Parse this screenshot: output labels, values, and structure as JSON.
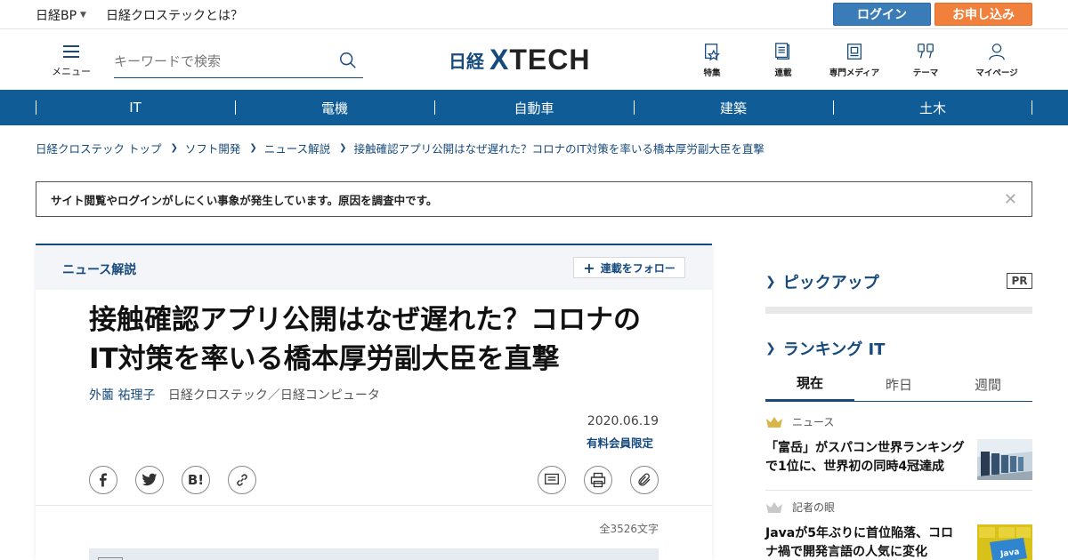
{
  "topbar": {
    "nikkei_bp": "日経BP",
    "about": "日経クロステックとは？",
    "login": "ログイン",
    "apply": "お申し込み"
  },
  "header": {
    "menu_label": "メニュー",
    "search_placeholder": "キーワードで検索",
    "logo_nikkei": "日経",
    "logo_x": "X",
    "logo_tech": "TECH",
    "nav": [
      {
        "label": "特集",
        "icon": "feature-icon"
      },
      {
        "label": "連載",
        "icon": "series-icon"
      },
      {
        "label": "専門メディア",
        "icon": "media-icon"
      },
      {
        "label": "テーマ",
        "icon": "theme-icon"
      },
      {
        "label": "マイページ",
        "icon": "user-icon"
      }
    ]
  },
  "categories": [
    "IT",
    "電機",
    "自動車",
    "建築",
    "土木"
  ],
  "breadcrumb": [
    "日経クロステック トップ",
    "ソフト開発",
    "ニュース解説",
    "接触確認アプリ公開はなぜ遅れた？コロナのIT対策を率いる橋本厚労副大臣を直撃"
  ],
  "notice": {
    "text": "サイト閲覧やログインがしにくい事象が発生しています。原因を調査中です。",
    "close": "✕"
  },
  "article": {
    "series": "ニュース解説",
    "follow": "連載をフォロー",
    "follow_plus": "+",
    "headline": "接触確認アプリ公開はなぜ遅れた？コロナのIT対策を率いる橋本厚労副大臣を直撃",
    "author": "外薗 祐理子",
    "publication": "日経クロステック／日経コンピュータ",
    "date": "2020.06.19",
    "paid": "有料会員限定",
    "word_count": "全3526文字",
    "share_icons": [
      "f",
      "t",
      "B!",
      "link"
    ],
    "tool_icons": [
      "comment",
      "print",
      "clip"
    ]
  },
  "sidebar": {
    "pickup": "ピックアップ",
    "pr": "PR",
    "ranking": "ランキング IT",
    "tabs": [
      "現在",
      "昨日",
      "週間"
    ],
    "active_tab": 0,
    "items": [
      {
        "category": "ニュース",
        "title": "「富岳」がスパコン世界ランキングで1位に、世界初の同時4冠達成",
        "crown_color": "#d9b64a"
      },
      {
        "category": "記者の眼",
        "title": "Javaが5年ぶりに首位陥落、コロナ禍で開発言語の人気に変化",
        "crown_color": "#c9c9c9"
      }
    ]
  },
  "colors": {
    "brand": "#174a7c",
    "category_bar": "#0f5c97",
    "login": "#3a7cb8",
    "apply": "#f0803c"
  }
}
